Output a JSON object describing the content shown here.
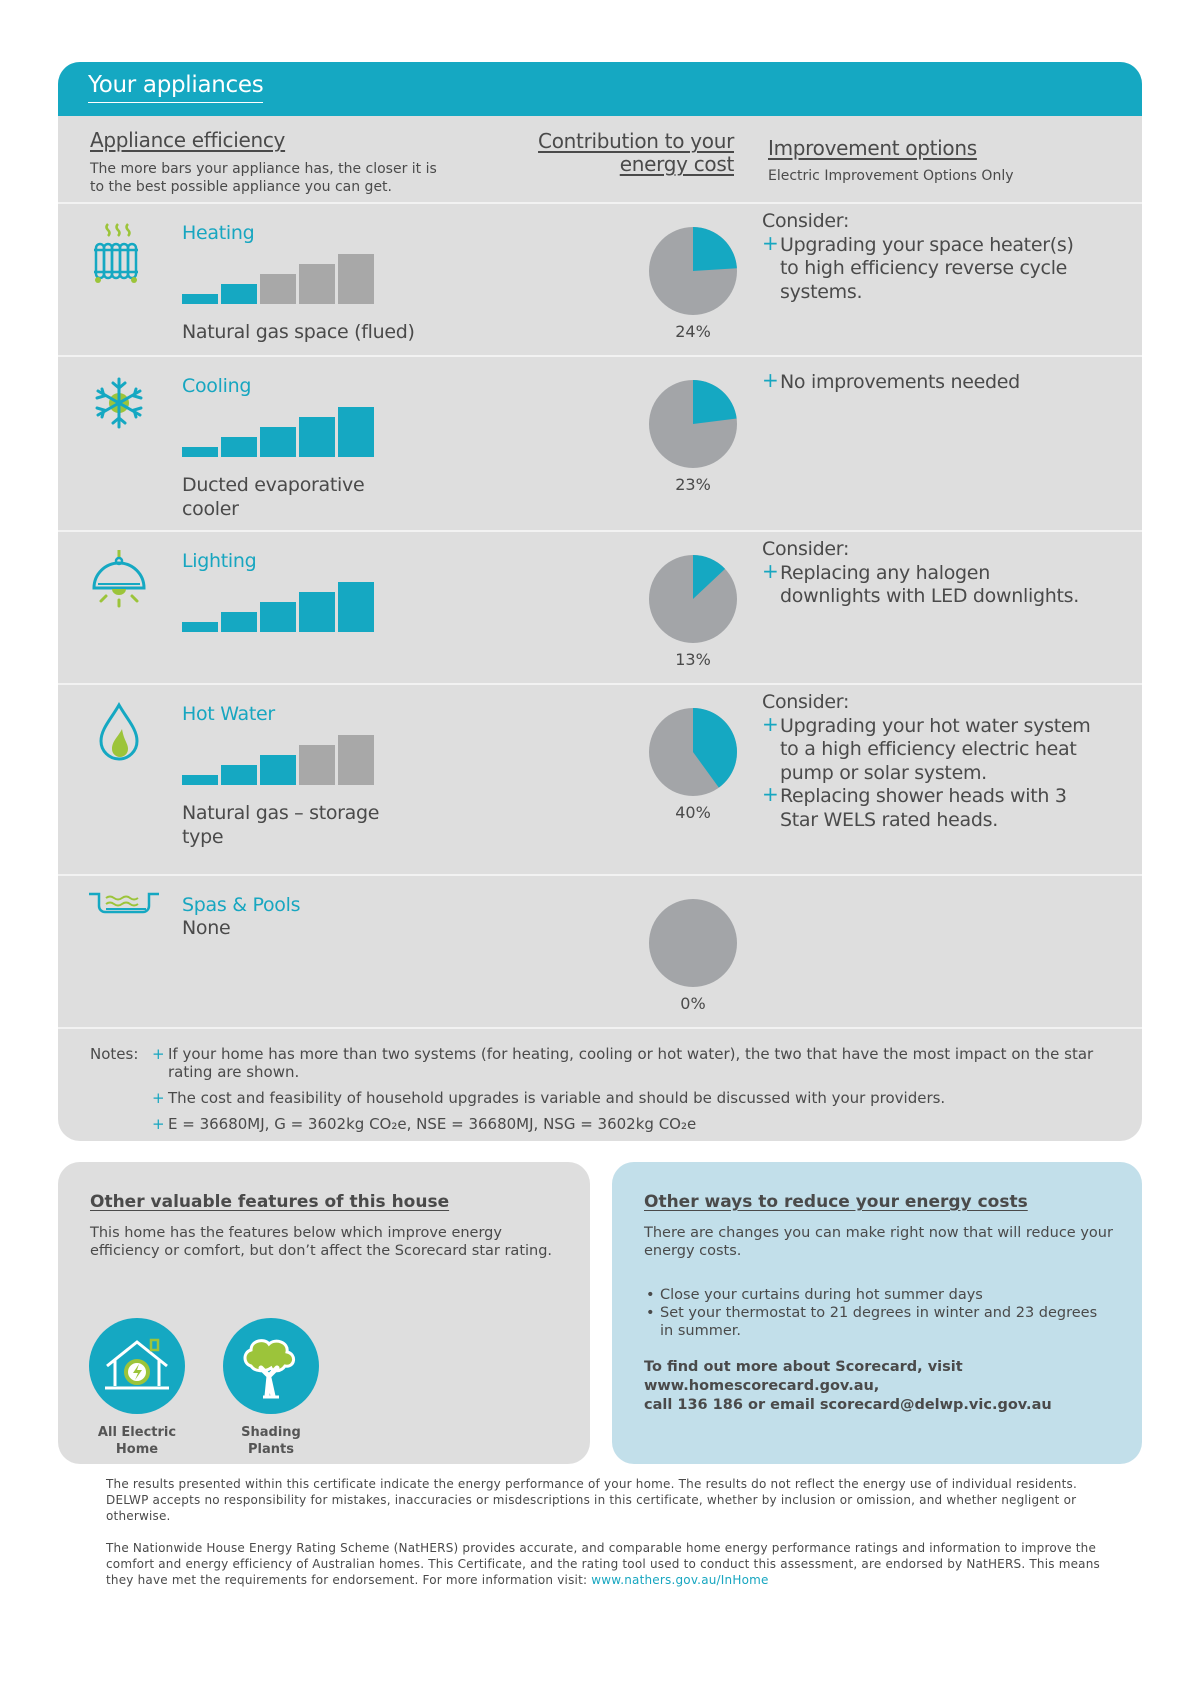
{
  "section": {
    "title": "Your appliances",
    "columns": {
      "efficiency_title": "Appliance efficiency",
      "efficiency_desc": "The more bars your appliance has, the closer it is to the best possible appliance you can get.",
      "contribution_title": "Contribution to your energy cost",
      "improvement_title": "Improvement options",
      "improvement_sub": "Electric Improvement Options Only"
    }
  },
  "colors": {
    "accent": "#15a8c2",
    "bar_off": "#a8a8a8",
    "pie_rest": "#a3a5a8",
    "highlight_green": "#9cc43a"
  },
  "appliances": [
    {
      "name": "Heating",
      "icon": "radiator-icon",
      "type": "Natural gas space (flued)",
      "bars_filled": 2,
      "bars_total": 5,
      "contribution_pct": 24,
      "contribution_label": "24%",
      "improvement_lead": "Consider:",
      "improvements": [
        "Upgrading your space heater(s) to high efficiency reverse cycle systems."
      ]
    },
    {
      "name": "Cooling",
      "icon": "snowflake-icon",
      "type": "Ducted evaporative cooler",
      "bars_filled": 5,
      "bars_total": 5,
      "contribution_pct": 23,
      "contribution_label": "23%",
      "improvement_lead": "",
      "improvements": [
        "No improvements needed"
      ]
    },
    {
      "name": "Lighting",
      "icon": "pendant-lamp-icon",
      "type": "",
      "bars_filled": 5,
      "bars_total": 5,
      "contribution_pct": 13,
      "contribution_label": "13%",
      "improvement_lead": "Consider:",
      "improvements": [
        "Replacing any halogen downlights with LED downlights."
      ]
    },
    {
      "name": "Hot Water",
      "icon": "water-flame-icon",
      "type": "Natural gas – storage type",
      "bars_filled": 3,
      "bars_total": 5,
      "contribution_pct": 40,
      "contribution_label": "40%",
      "improvement_lead": "Consider:",
      "improvements": [
        "Upgrading your hot water system to a high efficiency electric heat pump or solar system.",
        "Replacing shower heads with 3 Star WELS rated heads."
      ]
    },
    {
      "name": "Spas & Pools",
      "icon": "pool-icon",
      "type": "None",
      "bars_filled": 0,
      "bars_total": 0,
      "contribution_pct": 0,
      "contribution_label": "0%",
      "improvement_lead": "",
      "improvements": []
    }
  ],
  "notes": {
    "label": "Notes:",
    "items": [
      "If your home has more than two systems (for heating, cooling or hot water), the two that have the most impact on the star rating are shown.",
      "The cost and feasibility of household upgrades is variable and should be discussed with your providers.",
      "E = 36680MJ, G = 3602kg CO₂e, NSE = 36680MJ, NSG = 3602kg CO₂e"
    ]
  },
  "features_panel": {
    "title": "Other valuable features of this house",
    "desc": "This home has the features below which improve energy efficiency or comfort, but don’t affect the Scorecard star rating.",
    "features": [
      {
        "label_line1": "All Electric",
        "label_line2": "Home",
        "icon": "electric-home-icon"
      },
      {
        "label_line1": "Shading",
        "label_line2": "Plants",
        "icon": "tree-icon"
      }
    ]
  },
  "tips_panel": {
    "title": "Other ways to reduce your energy costs",
    "desc": "There are changes you can make right now that will reduce your energy costs.",
    "tips": [
      "Close your curtains during hot summer days",
      "Set your thermostat to 21 degrees in winter and 23 degrees in summer."
    ],
    "more_line1": "To find out more about Scorecard, visit",
    "more_line2": "www.homescorecard.gov.au,",
    "more_line3": "call 136 186 or email scorecard@delwp.vic.gov.au"
  },
  "footer": {
    "disclaimer": "The results presented within this certificate indicate the energy performance of your home. The results do not reflect the energy use of individual residents. DELWP accepts no responsibility for mistakes, inaccuracies or misdescriptions in this certificate, whether by inclusion or omission, and whether negligent or otherwise.",
    "nathers": "The Nationwide House Energy Rating Scheme (NatHERS) provides accurate, and comparable home energy performance ratings and information to improve the comfort and energy efficiency of Australian homes. This Certificate, and the rating tool used to conduct this assessment, are endorsed by NatHERS. This means they have met the requirements for endorsement. For more information visit: ",
    "link": "www.nathers.gov.au/InHome"
  }
}
